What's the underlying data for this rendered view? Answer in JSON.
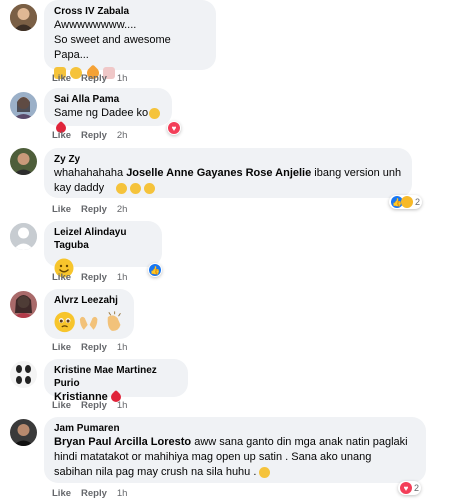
{
  "actions": {
    "like": "Like",
    "reply": "Reply"
  },
  "comments": [
    {
      "name": "Cross IV Zabala",
      "lines": [
        "Awwwwwwww....",
        "So sweet and awesome Papa..."
      ],
      "time": "1h"
    },
    {
      "name": "Sai Alla Pama",
      "text": "Same ng Dadee ko",
      "time": "2h"
    },
    {
      "name": "Zy Zy",
      "prefix": "whahahahaha ",
      "tags": "Joselle Anne Gayanes Rose Anjelie",
      "suffix": " ibang version unh kay daddy",
      "time": "2h",
      "reaction_count": "2"
    },
    {
      "name": "Leizel Alindayu Taguba",
      "time": "1h"
    },
    {
      "name": "Alvrz Leezahj",
      "time": "1h"
    },
    {
      "name": "Kristine Mae Martinez Purio",
      "text": "Kristianne",
      "time": "1h"
    },
    {
      "name": "Jam Pumaren",
      "tags": "Bryan Paul Arcilla Loresto",
      "text1": " aww sana ganto din mga anak natin paglaki",
      "text2": "hindi matatakot or mahihiya mag open up satin . Sana ako unang",
      "text3": "sabihan nila pag may crush na sila huhu . ",
      "time": "1h",
      "reaction_count": "2"
    }
  ],
  "colors": {
    "bubble": "#f0f2f5",
    "meta": "#65676b",
    "like_blue": "#1877f2",
    "love_red": "#f33e58"
  }
}
